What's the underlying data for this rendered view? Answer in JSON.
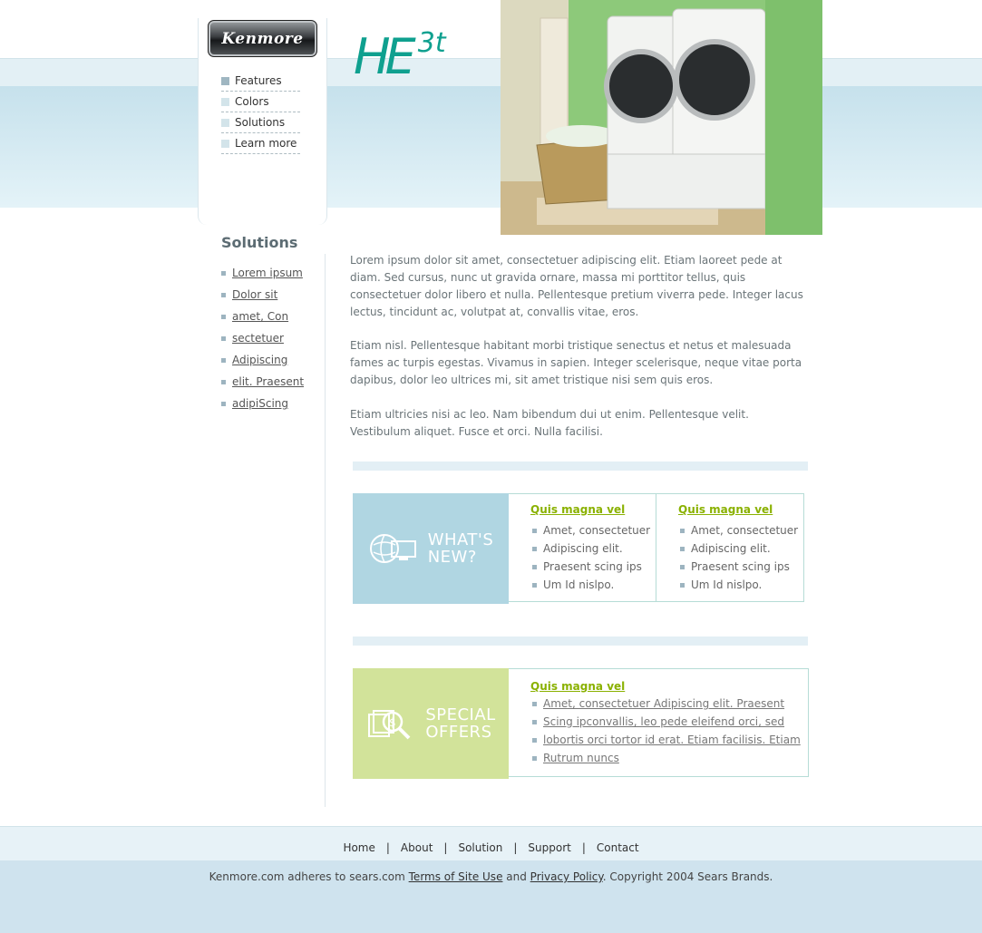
{
  "brand": {
    "logo_text": "Kenmore",
    "product_main": "HE",
    "product_sup": "3t"
  },
  "top_nav": [
    {
      "label": "Features"
    },
    {
      "label": "Colors"
    },
    {
      "label": "Solutions"
    },
    {
      "label": "Learn more"
    }
  ],
  "sidebar": {
    "title": "Solutions",
    "links": [
      "Lorem ipsum",
      "Dolor sit",
      "amet, Con",
      "sectetuer",
      "Adipiscing",
      "elit. Praesent",
      "adipiScing"
    ]
  },
  "content": {
    "paragraphs": [
      "Lorem ipsum dolor sit amet, consectetuer adipiscing elit. Etiam laoreet pede at diam. Sed cursus, nunc ut gravida ornare, massa mi porttitor tellus, quis consectetuer dolor libero et nulla. Pellentesque pretium viverra pede. Integer lacus lectus, tincidunt ac, volutpat at, convallis vitae, eros.",
      "Etiam nisl. Pellentesque habitant morbi tristique senectus et netus et malesuada fames ac turpis egestas. Vivamus in sapien. Integer scelerisque, neque vitae porta dapibus, dolor leo ultrices mi, sit amet tristique nisi sem quis eros.",
      "Etiam ultricies nisi ac leo. Nam bibendum dui ut enim. Pellentesque velit. Vestibulum aliquet. Fusce et orci. Nulla facilisi."
    ]
  },
  "whats_new": {
    "line1": "WHAT'S",
    "line2": "NEW?",
    "tile_color": "#b0d6e2",
    "columns": [
      {
        "heading": "Quis magna vel",
        "items": [
          "Amet, consectetuer",
          "Adipiscing elit.",
          "Praesent scing ips",
          "Um Id nislpo."
        ]
      },
      {
        "heading": "Quis magna vel",
        "items": [
          "Amet, consectetuer",
          "Adipiscing elit.",
          "Praesent scing ips",
          "Um Id nislpo."
        ]
      }
    ]
  },
  "special_offers": {
    "line1": "SPECIAL",
    "line2": "OFFERS",
    "tile_color": "#d2e39a",
    "heading": "Quis magna vel",
    "items": [
      "Amet, consectetuer Adipiscing elit. Praesent",
      "Scing ipconvallis, leo pede eleifend orci, sed",
      "lobortis orci tortor id erat. Etiam facilisis. Etiam",
      "Rutrum nuncs"
    ]
  },
  "footer": {
    "nav": [
      "Home",
      "About",
      "Solution",
      "Support",
      "Contact"
    ],
    "separator": "|",
    "copy_prefix": "Kenmore.com adheres to sears.com ",
    "terms": "Terms of Site Use",
    "and": " and ",
    "privacy": "Privacy Policy",
    "copy_suffix": ".  Copyright 2004 Sears Brands."
  },
  "colors": {
    "accent_green": "#8ab100",
    "brand_teal": "#0fa08f",
    "header_blue": "#c6e1ec"
  }
}
